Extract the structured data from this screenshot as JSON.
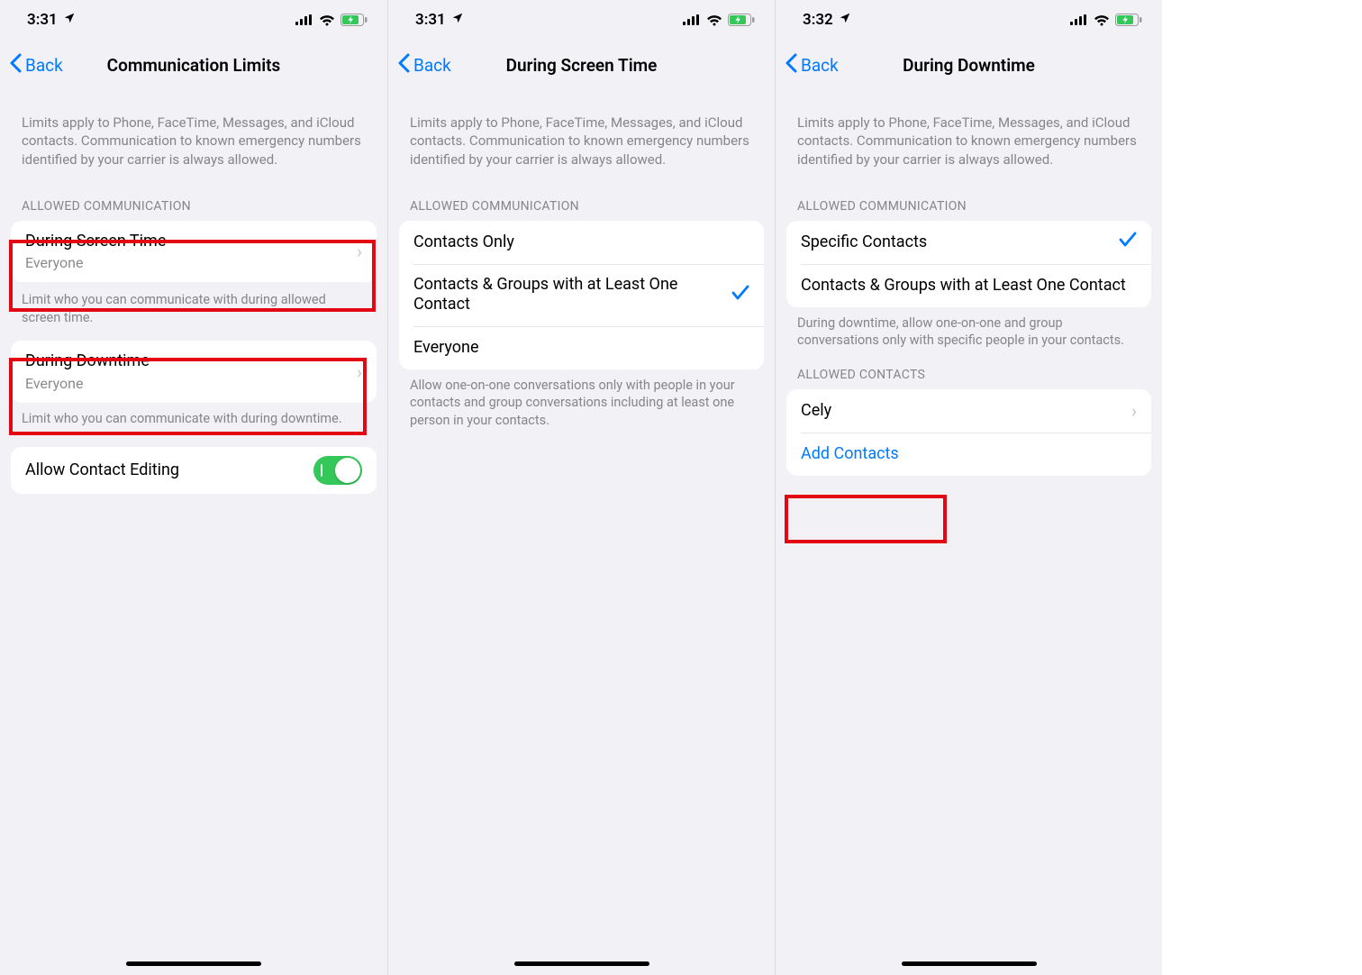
{
  "colors": {
    "link": "#007aff",
    "toggle_on": "#34c759",
    "highlight": "#e30613"
  },
  "screens": [
    {
      "status": {
        "time": "3:31"
      },
      "nav": {
        "back": "Back",
        "title": "Communication Limits"
      },
      "intro": "Limits apply to Phone, FaceTime, Messages, and iCloud contacts. Communication to known emergency numbers identified by your carrier is always allowed.",
      "section_allowed_header": "ALLOWED COMMUNICATION",
      "rows_allowed": {
        "during_screen_time": {
          "title": "During Screen Time",
          "subtitle": "Everyone"
        },
        "during_downtime": {
          "title": "During Downtime",
          "subtitle": "Everyone"
        }
      },
      "footer_screen": "Limit who you can communicate with during allowed screen time.",
      "footer_downtime": "Limit who you can communicate with during downtime.",
      "allow_contact_editing": {
        "label": "Allow Contact Editing",
        "on": true
      }
    },
    {
      "status": {
        "time": "3:31"
      },
      "nav": {
        "back": "Back",
        "title": "During Screen Time"
      },
      "intro": "Limits apply to Phone, FaceTime, Messages, and iCloud contacts. Communication to known emergency numbers identified by your carrier is always allowed.",
      "section_allowed_header": "ALLOWED COMMUNICATION",
      "options": {
        "contacts_only": "Contacts Only",
        "contacts_groups": "Contacts & Groups with at Least One Contact",
        "everyone": "Everyone",
        "selected": "contacts_groups"
      },
      "footer": "Allow one-on-one conversations only with people in your contacts and group conversations including at least one person in your contacts."
    },
    {
      "status": {
        "time": "3:32"
      },
      "nav": {
        "back": "Back",
        "title": "During Downtime"
      },
      "intro": "Limits apply to Phone, FaceTime, Messages, and iCloud contacts. Communication to known emergency numbers identified by your carrier is always allowed.",
      "section_allowed_header": "ALLOWED COMMUNICATION",
      "options": {
        "specific_contacts": "Specific Contacts",
        "contacts_groups": "Contacts & Groups with at Least One Contact",
        "selected": "specific_contacts"
      },
      "footer": "During downtime, allow one-on-one and group conversations only with specific people in your contacts.",
      "section_contacts_header": "ALLOWED CONTACTS",
      "contacts": {
        "cely": "Cely",
        "add": "Add Contacts"
      }
    }
  ]
}
